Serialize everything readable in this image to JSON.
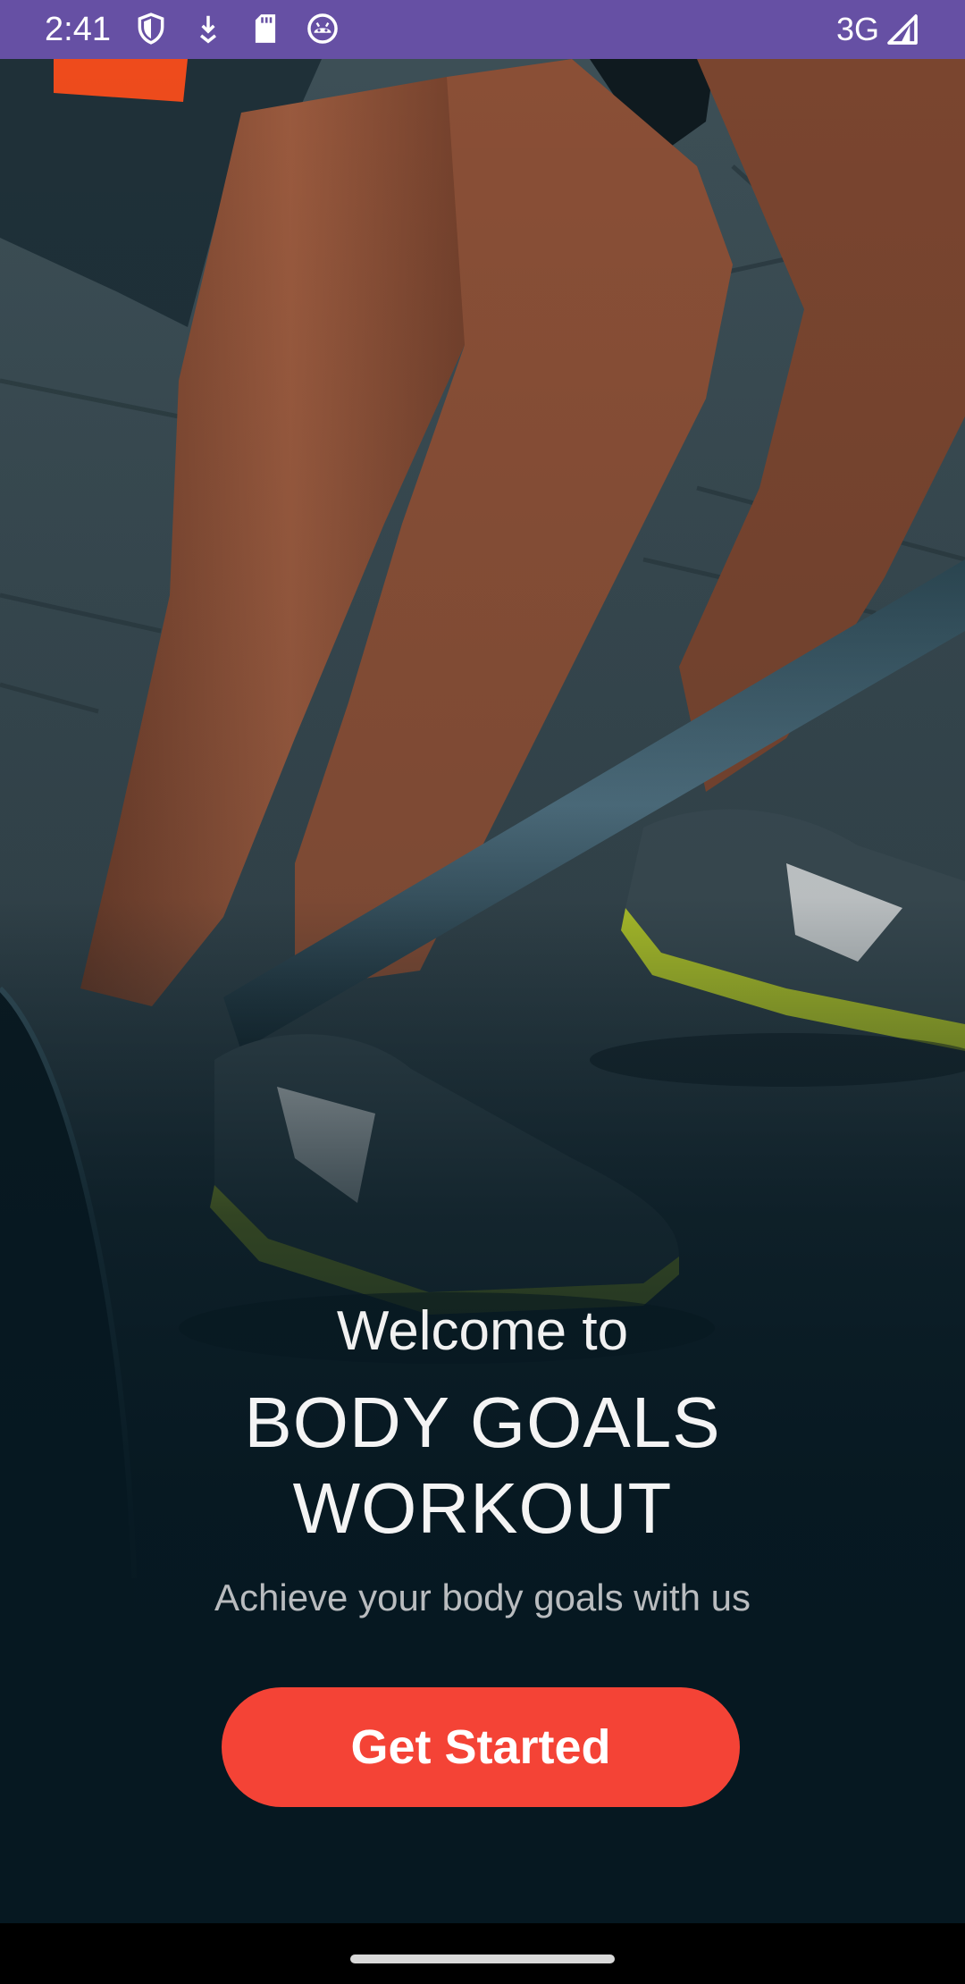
{
  "status_bar": {
    "time": "2:41",
    "network": "3G",
    "left_icons": [
      "shield-icon",
      "download-icon",
      "sd-card-icon",
      "android-icon"
    ],
    "right_icons": [
      "signal-icon"
    ],
    "background_color": "#6650a4"
  },
  "hero": {
    "image_subject": "athlete-legs-with-barbell-photo"
  },
  "welcome": {
    "intro": "Welcome to",
    "title_line1": "BODY GOALS",
    "title_line2": "WORKOUT",
    "tagline": "Achieve your body goals with us"
  },
  "cta": {
    "label": "Get Started",
    "color": "#f44336"
  },
  "theme": {
    "background": "#061821",
    "text_primary": "#f4f4f4",
    "text_secondary": "#b9bcbf"
  }
}
